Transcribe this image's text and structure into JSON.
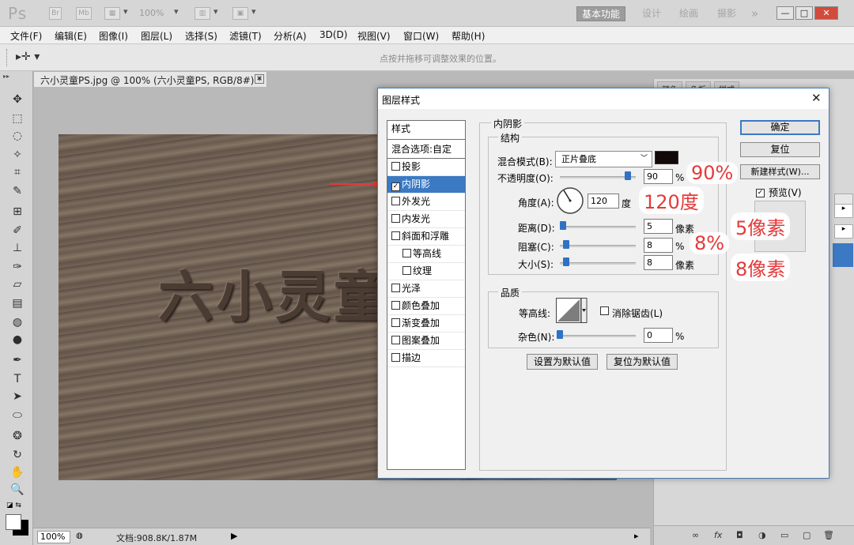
{
  "app": {
    "logo": "Ps",
    "bridge_label": "Br",
    "minibridge_label": "Mb",
    "zoom": "100%",
    "workspaces": [
      "基本功能",
      "设计",
      "绘画",
      "摄影"
    ],
    "workspace_more": "»",
    "window_buttons": [
      "—",
      "□",
      "✕"
    ]
  },
  "menu": [
    "文件(F)",
    "编辑(E)",
    "图像(I)",
    "图层(L)",
    "选择(S)",
    "滤镜(T)",
    "分析(A)",
    "3D(D)",
    "视图(V)",
    "窗口(W)",
    "帮助(H)"
  ],
  "options": {
    "hint": "点按并拖移可调整效果的位置。"
  },
  "document": {
    "tab_title": "六小灵童PS.jpg @ 100% (六小灵童PS, RGB/8#) *",
    "close": "✕",
    "engraved_text": "六小灵童"
  },
  "status": {
    "zoom": "100%",
    "doc_info": "文档:908.8K/1.87M"
  },
  "right_panel": {
    "tabs": [
      "颜色",
      "色板",
      "样式"
    ],
    "bottom_icons": [
      "∞",
      "fx",
      "◘",
      "◑",
      "▭",
      "▢",
      "🗑"
    ]
  },
  "dialog": {
    "title": "图层样式",
    "close": "✕",
    "styles_header": "样式",
    "blend_options": "混合选项:自定",
    "styles": [
      {
        "label": "投影",
        "checked": false,
        "selected": false,
        "indent": false
      },
      {
        "label": "内阴影",
        "checked": true,
        "selected": true,
        "indent": false
      },
      {
        "label": "外发光",
        "checked": false,
        "selected": false,
        "indent": false
      },
      {
        "label": "内发光",
        "checked": false,
        "selected": false,
        "indent": false
      },
      {
        "label": "斜面和浮雕",
        "checked": false,
        "selected": false,
        "indent": false
      },
      {
        "label": "等高线",
        "checked": false,
        "selected": false,
        "indent": true
      },
      {
        "label": "纹理",
        "checked": false,
        "selected": false,
        "indent": true
      },
      {
        "label": "光泽",
        "checked": false,
        "selected": false,
        "indent": false
      },
      {
        "label": "颜色叠加",
        "checked": false,
        "selected": false,
        "indent": false
      },
      {
        "label": "渐变叠加",
        "checked": false,
        "selected": false,
        "indent": false
      },
      {
        "label": "图案叠加",
        "checked": false,
        "selected": false,
        "indent": false
      },
      {
        "label": "描边",
        "checked": false,
        "selected": false,
        "indent": false
      }
    ],
    "section_title": "内阴影",
    "structure": {
      "title": "结构",
      "blend_mode_label": "混合模式(B):",
      "blend_mode_value": "正片叠底",
      "shadow_color": "#120808",
      "opacity_label": "不透明度(O):",
      "opacity_value": "90",
      "opacity_fraction": 0.9,
      "percent": "%",
      "angle_label": "角度(A):",
      "angle_value": "120",
      "degree": "度",
      "distance_label": "距离(D):",
      "distance_value": "5",
      "choke_label": "阻塞(C):",
      "choke_value": "8",
      "size_label": "大小(S):",
      "size_value": "8",
      "pixels": "像素"
    },
    "quality": {
      "title": "品质",
      "contour_label": "等高线:",
      "antialias_label": "消除锯齿(L)",
      "noise_label": "杂色(N):",
      "noise_value": "0"
    },
    "make_default": "设置为默认值",
    "reset_default": "复位为默认值",
    "ok": "确定",
    "reset": "复位",
    "new_style": "新建样式(W)...",
    "preview_label": "预览(V)",
    "preview_checked": true
  },
  "annotations": {
    "opacity": "90%",
    "angle": "120度",
    "distance": "5像素",
    "choke": "8%",
    "size": "8像素"
  }
}
